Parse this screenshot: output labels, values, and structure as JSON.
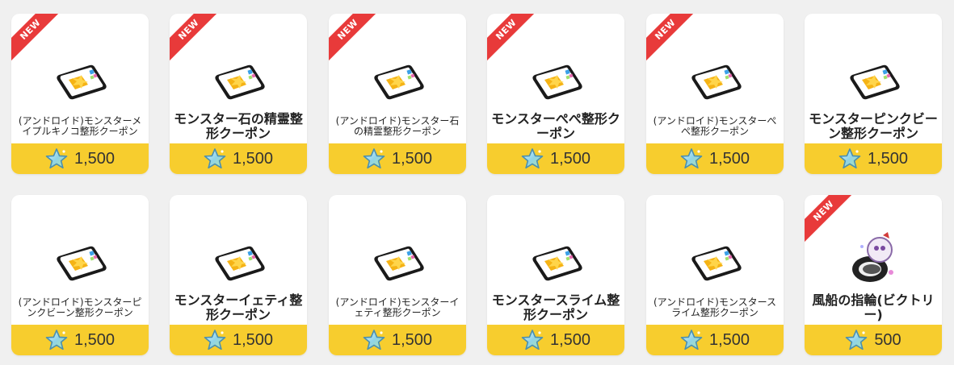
{
  "items": [
    {
      "name": "(アンドロイド)モンスターメイプルキノコ整形クーポン",
      "price": "1,500",
      "badge": "NEW",
      "icon": "coupon-icon",
      "size": "small"
    },
    {
      "name": "モンスター石の精霊整形クーポン",
      "price": "1,500",
      "badge": "NEW",
      "icon": "coupon-icon",
      "size": "big"
    },
    {
      "name": "(アンドロイド)モンスター石の精霊整形クーポン",
      "price": "1,500",
      "badge": "NEW",
      "icon": "coupon-icon",
      "size": "small"
    },
    {
      "name": "モンスターぺぺ整形クーポン",
      "price": "1,500",
      "badge": "NEW",
      "icon": "coupon-icon",
      "size": "big"
    },
    {
      "name": "(アンドロイド)モンスターぺぺ整形クーポン",
      "price": "1,500",
      "badge": "NEW",
      "icon": "coupon-icon",
      "size": "small"
    },
    {
      "name": "モンスターピンクビーン整形クーポン",
      "price": "1,500",
      "badge": "",
      "icon": "coupon-icon",
      "size": "big"
    },
    {
      "name": "(アンドロイド)モンスターピンクビーン整形クーポン",
      "price": "1,500",
      "badge": "",
      "icon": "coupon-icon",
      "size": "small"
    },
    {
      "name": "モンスターイェティ整形クーポン",
      "price": "1,500",
      "badge": "",
      "icon": "coupon-icon",
      "size": "big"
    },
    {
      "name": "(アンドロイド)モンスターイェティ整形クーポン",
      "price": "1,500",
      "badge": "",
      "icon": "coupon-icon",
      "size": "small"
    },
    {
      "name": "モンスタースライム整形クーポン",
      "price": "1,500",
      "badge": "",
      "icon": "coupon-icon",
      "size": "big"
    },
    {
      "name": "(アンドロイド)モンスタースライム整形クーポン",
      "price": "1,500",
      "badge": "",
      "icon": "coupon-icon",
      "size": "small"
    },
    {
      "name": "風船の指輪(ビクトリー)",
      "price": "500",
      "badge": "NEW",
      "icon": "balloon-ring-icon",
      "size": "big"
    }
  ],
  "colors": {
    "price_bar": "#f7cd2e",
    "badge": "#e83a3a",
    "background": "#f0f0f0"
  }
}
